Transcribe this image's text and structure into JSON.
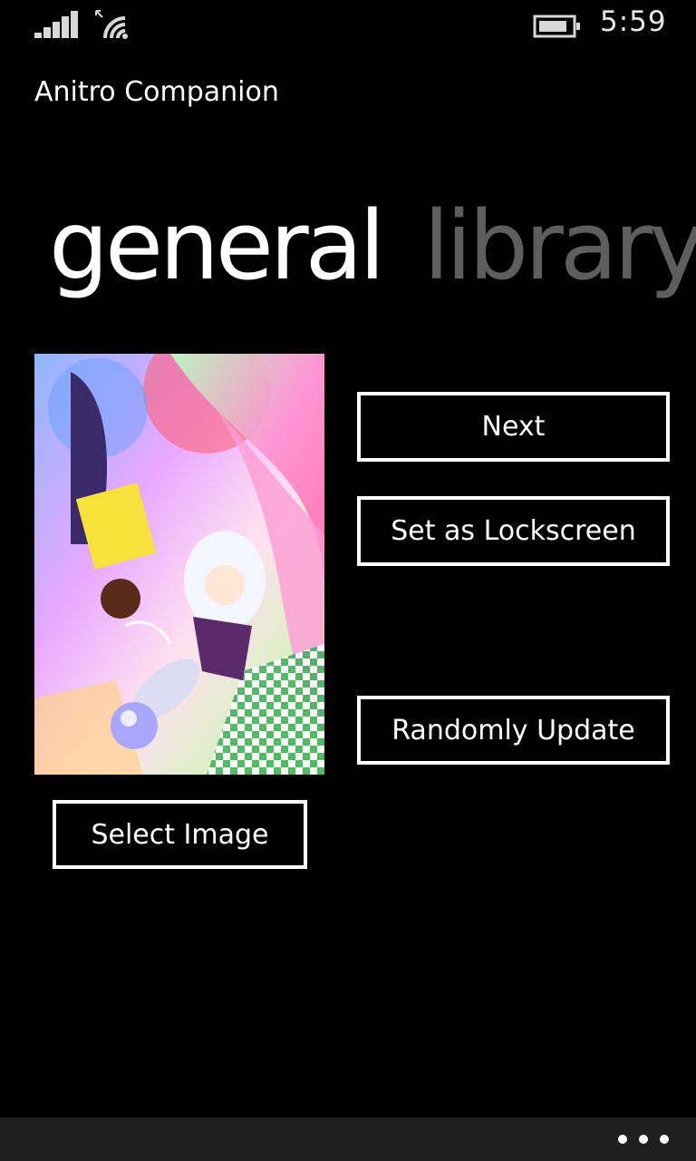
{
  "status_bar": {
    "time": "5:59",
    "signal_icon": "cellular-signal-icon",
    "wifi_icon": "wifi-icon",
    "battery_icon": "battery-icon"
  },
  "app": {
    "title": "Anitro Companion"
  },
  "pivot": {
    "items": [
      "general",
      "library"
    ],
    "active_index": 0
  },
  "artwork": {
    "icon": "anime-artwork-image"
  },
  "buttons": {
    "next": "Next",
    "set_lockscreen": "Set as Lockscreen",
    "randomly_update": "Randomly Update",
    "select_image": "Select Image"
  },
  "app_bar": {
    "more_icon": "ellipsis-icon"
  },
  "colors": {
    "background": "#000000",
    "foreground": "#ffffff",
    "inactive_pivot": "#5e5e5e",
    "app_bar": "#1f1f1f"
  }
}
